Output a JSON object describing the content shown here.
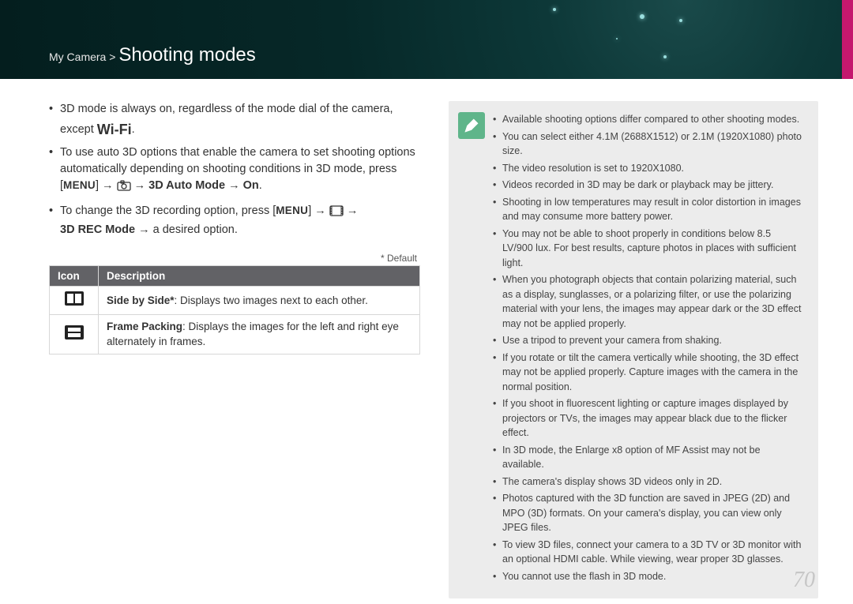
{
  "header": {
    "breadcrumb_prefix": "My Camera > ",
    "page_title": "Shooting modes"
  },
  "left": {
    "bullet1": "3D mode is always on, regardless of the mode dial of the camera, except ",
    "wifi_text": "Wi-Fi",
    "bullet1_tail": ".",
    "bullet2_lead": "To use auto 3D options that enable the camera to set shooting options automatically depending on shooting conditions in 3D mode, press [",
    "menu_word": "MENU",
    "bullet2_arrow1": "] → ",
    "bullet2_arrow2": " → ",
    "bullet2_bold": "3D Auto Mode → On",
    "bullet2_end": ".",
    "bullet3_lead": "To change the 3D recording option, press [",
    "bullet3_arrow1": "] → ",
    "bullet3_arrow2": " → ",
    "bullet3_bold": "3D REC Mode",
    "bullet3_tail": " → a desired option.",
    "default_marker": "* Default",
    "table": {
      "h_icon": "Icon",
      "h_desc": "Description",
      "row1_bold": "Side by Side*",
      "row1_rest": ": Displays two images next to each other.",
      "row2_bold": "Frame Packing",
      "row2_rest": ": Displays the images for the left and right eye alternately in frames."
    }
  },
  "notes": {
    "items": [
      "Available shooting options differ compared to other shooting modes.",
      "You can select either 4.1M (2688X1512) or 2.1M (1920X1080) photo size.",
      "The video resolution is set to 1920X1080.",
      "Videos recorded in 3D may be dark or playback may be jittery.",
      "Shooting in low temperatures may result in color distortion in images and may consume more battery power.",
      "You may not be able to shoot properly in conditions below 8.5 LV/900 lux. For best results, capture photos in places with sufficient light.",
      "When you photograph objects that contain polarizing material, such as a display, sunglasses, or a polarizing filter, or use the polarizing material with your lens, the images may appear dark or the 3D effect may not be applied properly.",
      "Use a tripod to prevent your camera from shaking.",
      "If you rotate or tilt the camera vertically while shooting, the 3D effect may not be applied properly. Capture images with the camera in the normal position.",
      "If you shoot in fluorescent lighting or capture images displayed by projectors or TVs, the images may appear black due to the flicker effect.",
      "In 3D mode, the Enlarge x8 option of MF Assist may not be available.",
      "The camera's display shows 3D videos only in 2D.",
      "Photos captured with the 3D function are saved in JPEG (2D) and MPO (3D) formats. On your camera's display, you can view only JPEG files.",
      "To view 3D files, connect your camera to a 3D TV or 3D monitor with an optional HDMI cable. While viewing, wear proper 3D glasses.",
      "You cannot use the flash in 3D mode."
    ]
  },
  "page_number": "70"
}
